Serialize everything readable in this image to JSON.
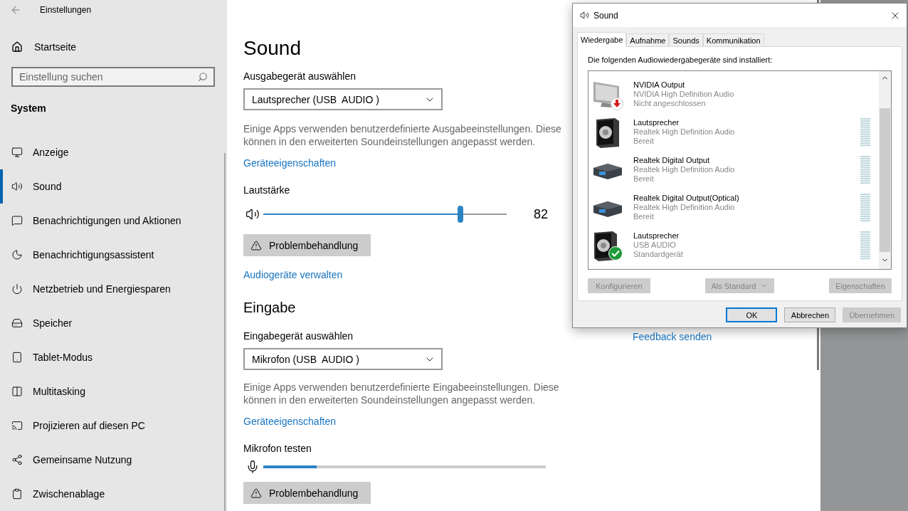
{
  "settings_window": {
    "title": "Einstellungen"
  },
  "sidebar": {
    "home": "Startseite",
    "search": {
      "placeholder": "Einstellung suchen"
    },
    "section": "System",
    "items": [
      {
        "label": "Anzeige",
        "selected": false
      },
      {
        "label": "Sound",
        "selected": true
      },
      {
        "label": "Benachrichtigungen und Aktionen",
        "selected": false
      },
      {
        "label": "Benachrichtigungsassistent",
        "selected": false
      },
      {
        "label": "Netzbetrieb und Energiesparen",
        "selected": false
      },
      {
        "label": "Speicher",
        "selected": false
      },
      {
        "label": "Tablet-Modus",
        "selected": false
      },
      {
        "label": "Multitasking",
        "selected": false
      },
      {
        "label": "Projizieren auf diesen PC",
        "selected": false
      },
      {
        "label": "Gemeinsame Nutzung",
        "selected": false
      },
      {
        "label": "Zwischenablage",
        "selected": false
      }
    ]
  },
  "main": {
    "title": "Sound",
    "output": {
      "label": "Ausgabegerät auswählen",
      "device": "Lautsprecher (USB  AUDIO )",
      "description": "Einige Apps verwenden benutzerdefinierte Ausgabeeinstellungen. Diese können in den erweiterten Soundeinstellungen angepasst werden.",
      "properties_link": "Geräteeigenschaften",
      "volume_label": "Lautstärke",
      "volume": {
        "level": 0.81,
        "reading": "82"
      },
      "troubleshoot": "Problembehandlung",
      "manage_link": "Audiogeräte verwalten"
    },
    "input": {
      "heading": "Eingabe",
      "label": "Eingabegerät auswählen",
      "device": "Mikrofon (USB  AUDIO )",
      "description": "Einige Apps verwenden benutzerdefinierte Eingabeeinstellungen. Diese können in den erweiterten Soundeinstellungen angepasst werden.",
      "properties_link": "Geräteeigenschaften",
      "test_label": "Mikrofon testen",
      "mic": {
        "level": 0.19
      },
      "troubleshoot": "Problembehandlung"
    },
    "feedback_link": "Feedback senden"
  },
  "dialog": {
    "title": "Sound",
    "tabs": [
      {
        "label": "Wiedergabe",
        "selected": true
      },
      {
        "label": "Aufnahme",
        "selected": false
      },
      {
        "label": "Sounds",
        "selected": false
      },
      {
        "label": "Kommunikation",
        "selected": false
      }
    ],
    "heading": "Die folgenden Audiowiedergabegeräte sind installiert:",
    "devices": [
      {
        "kind": "monitor",
        "disconnected": true,
        "default": false,
        "meter": false,
        "name": "NVIDIA Output",
        "driver": "NVIDIA High Definition Audio",
        "status": "Nicht angeschlossen"
      },
      {
        "kind": "speaker",
        "disconnected": false,
        "default": false,
        "meter": true,
        "name": "Lautsprecher",
        "driver": "Realtek High Definition Audio",
        "status": "Bereit"
      },
      {
        "kind": "digital",
        "disconnected": false,
        "default": false,
        "meter": true,
        "name": "Realtek Digital Output",
        "driver": "Realtek High Definition Audio",
        "status": "Bereit"
      },
      {
        "kind": "digital",
        "disconnected": false,
        "default": false,
        "meter": true,
        "name": "Realtek Digital Output(Optical)",
        "driver": "Realtek High Definition Audio",
        "status": "Bereit"
      },
      {
        "kind": "speaker",
        "disconnected": false,
        "default": true,
        "meter": true,
        "name": "Lautsprecher",
        "driver": "USB  AUDIO",
        "status": "Standardgerät"
      }
    ],
    "actions": [
      {
        "label": "Konfigurieren",
        "disabled": true,
        "dropdown": false
      },
      {
        "label": "Als Standard",
        "disabled": true,
        "dropdown": true
      },
      {
        "label": "Eigenschaften",
        "disabled": true,
        "dropdown": false
      }
    ],
    "buttons": [
      {
        "label": "OK",
        "default": true,
        "disabled": false
      },
      {
        "label": "Abbrechen",
        "default": false,
        "disabled": false
      },
      {
        "label": "Übernehmen",
        "default": false,
        "disabled": true
      }
    ]
  }
}
